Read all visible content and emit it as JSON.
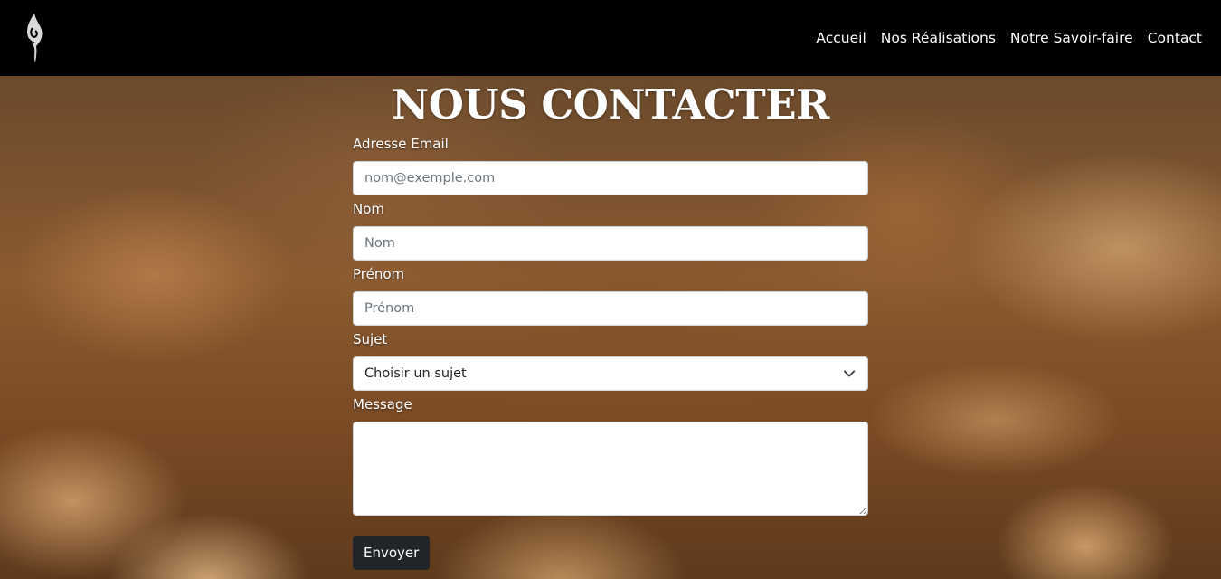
{
  "nav": {
    "logo_icon": "stylized-feather-logo-icon",
    "links": [
      "Accueil",
      "Nos Réalisations",
      "Notre Savoir-faire",
      "Contact"
    ]
  },
  "main": {
    "title": "NOUS CONTACTER",
    "fields": {
      "email": {
        "label": "Adresse Email",
        "placeholder": "nom@exemple.com",
        "value": ""
      },
      "nom": {
        "label": "Nom",
        "placeholder": "Nom",
        "value": ""
      },
      "prenom": {
        "label": "Prénom",
        "placeholder": "Prénom",
        "value": ""
      },
      "sujet": {
        "label": "Sujet",
        "selected": "Choisir un sujet"
      },
      "message": {
        "label": "Message",
        "value": ""
      }
    },
    "submit_label": "Envoyer"
  },
  "colors": {
    "navbar_bg": "#000000",
    "button_bg": "#212529",
    "text": "#ffffff"
  }
}
